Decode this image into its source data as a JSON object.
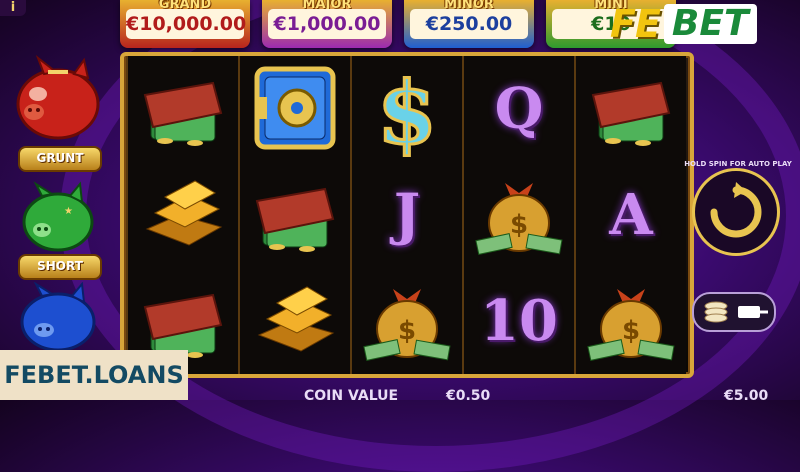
{
  "header": {
    "info_label": "i"
  },
  "jackpots": [
    {
      "name": "GRAND",
      "amount": "€10,000.00"
    },
    {
      "name": "MAJOR",
      "amount": "€1,000.00"
    },
    {
      "name": "MINOR",
      "amount": "€250.00"
    },
    {
      "name": "MINI",
      "amount": "€10"
    }
  ],
  "logo": {
    "part1": "FE",
    "part2": "BET"
  },
  "piggies": [
    {
      "label": "GRUNT",
      "color": "#c8221a"
    },
    {
      "label": "SHORT",
      "color": "#2faa3a"
    },
    {
      "label": "",
      "color": "#1d4fd0"
    }
  ],
  "reels": [
    [
      "wallet-icon",
      "gold-bars-icon",
      "wallet-icon"
    ],
    [
      "safe-icon",
      "wallet-icon",
      "gold-bars-icon"
    ],
    [
      "dollar-sign-icon",
      "J",
      "money-bag-icon"
    ],
    [
      "Q",
      "money-bag-icon",
      "10"
    ],
    [
      "wallet-icon",
      "A",
      "money-bag-icon"
    ]
  ],
  "controls": {
    "hold_spin_label": "HOLD SPIN FOR AUTO PLAY"
  },
  "footer": {
    "coin_value_label": "COIN VALUE",
    "coin_value": "€0.50",
    "bet_value": "€5.00"
  },
  "watermark": "FEBET.LOANS",
  "colors": {
    "accent": "#e8c450",
    "reel_frame": "#d8a63a",
    "background": "#3a0a6e"
  }
}
